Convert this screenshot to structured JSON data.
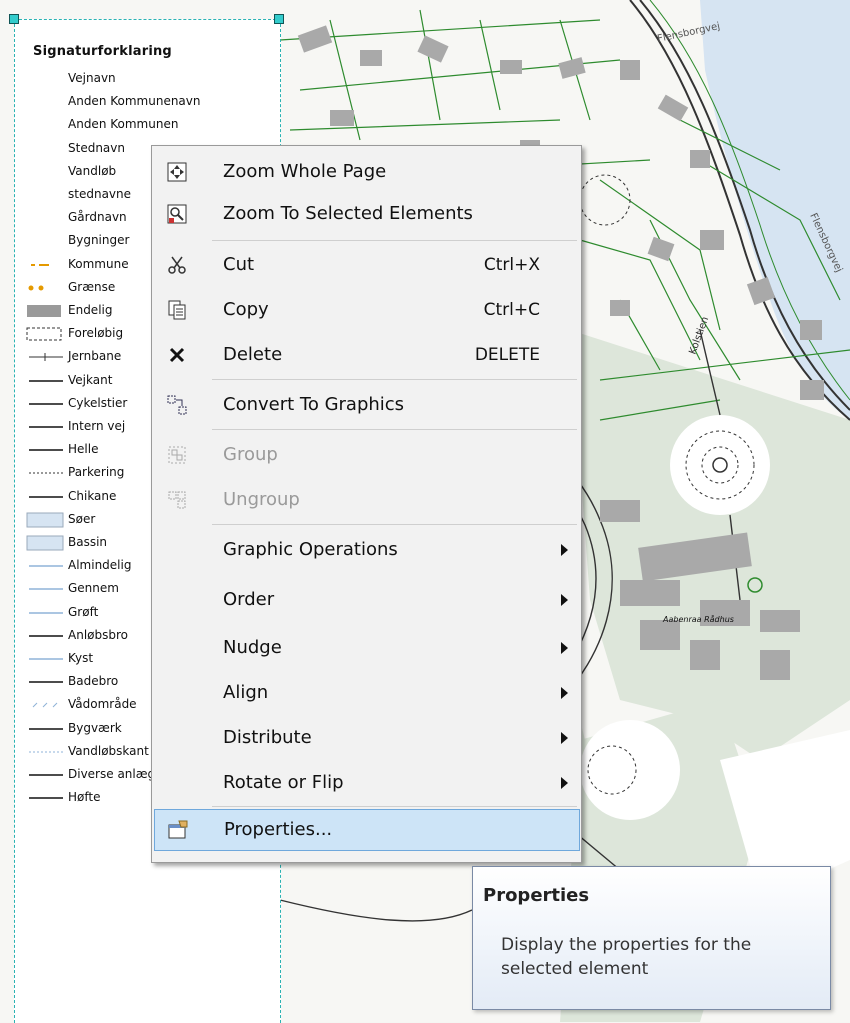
{
  "map": {
    "street_labels": [
      "Flensborgvej",
      "Flensborgvej",
      "Kolstien"
    ],
    "building_label": "Aabenraa Rådhus"
  },
  "legend": {
    "title": "Signaturforklaring",
    "items": [
      {
        "label": "Vejnavn",
        "symbol": "none"
      },
      {
        "label": "Anden Kommunenavn",
        "symbol": "none"
      },
      {
        "label": "Anden Kommunen",
        "symbol": "none"
      },
      {
        "label": "Stednavn",
        "symbol": "none"
      },
      {
        "label": "Vandløb",
        "symbol": "none"
      },
      {
        "label": "stednavne",
        "symbol": "none"
      },
      {
        "label": "Gårdnavn",
        "symbol": "none"
      },
      {
        "label": "Bygninger",
        "symbol": "none"
      },
      {
        "label": "Kommune",
        "symbol": "dash-dot-orange"
      },
      {
        "label": "Grænse",
        "symbol": "dots-orange"
      },
      {
        "label": "Endelig",
        "symbol": "fill-gray"
      },
      {
        "label": "Foreløbig",
        "symbol": "dashed-box"
      },
      {
        "label": "Jernbane",
        "symbol": "rail"
      },
      {
        "label": "Vejkant",
        "symbol": "line"
      },
      {
        "label": "Cykelstier",
        "symbol": "line"
      },
      {
        "label": "Intern vej",
        "symbol": "line"
      },
      {
        "label": "Helle",
        "symbol": "line"
      },
      {
        "label": "Parkering",
        "symbol": "dotted"
      },
      {
        "label": "Chikane",
        "symbol": "line"
      },
      {
        "label": "Søer",
        "symbol": "fill-blue"
      },
      {
        "label": "Bassin",
        "symbol": "fill-blue"
      },
      {
        "label": "Almindelig",
        "symbol": "line-blue"
      },
      {
        "label": "Gennem",
        "symbol": "line-blue"
      },
      {
        "label": "Grøft",
        "symbol": "line-blue"
      },
      {
        "label": "Anløbsbro",
        "symbol": "line"
      },
      {
        "label": "Kyst",
        "symbol": "line-blue"
      },
      {
        "label": "Badebro",
        "symbol": "line"
      },
      {
        "label": "Vådområde",
        "symbol": "marsh"
      },
      {
        "label": "Bygværk",
        "symbol": "line"
      },
      {
        "label": "Vandløbskant",
        "symbol": "dotted-blue"
      },
      {
        "label": "Diverse anlæg",
        "symbol": "line"
      },
      {
        "label": "Høfte",
        "symbol": "line"
      }
    ]
  },
  "context_menu": {
    "items": [
      {
        "label": "Zoom Whole Page",
        "icon": "zoom-whole-page-icon",
        "shortcut": "",
        "submenu": false,
        "disabled": false
      },
      {
        "label": "Zoom To Selected Elements",
        "icon": "zoom-selected-icon",
        "shortcut": "",
        "submenu": false,
        "disabled": false
      },
      {
        "label": "Cut",
        "icon": "scissors-icon",
        "shortcut": "Ctrl+X",
        "submenu": false,
        "disabled": false
      },
      {
        "label": "Copy",
        "icon": "copy-icon",
        "shortcut": "Ctrl+C",
        "submenu": false,
        "disabled": false
      },
      {
        "label": "Delete",
        "icon": "delete-x-icon",
        "shortcut": "DELETE",
        "submenu": false,
        "disabled": false
      },
      {
        "label": "Convert To Graphics",
        "icon": "convert-graphics-icon",
        "shortcut": "",
        "submenu": false,
        "disabled": false
      },
      {
        "label": "Group",
        "icon": "group-icon",
        "shortcut": "",
        "submenu": false,
        "disabled": true
      },
      {
        "label": "Ungroup",
        "icon": "ungroup-icon",
        "shortcut": "",
        "submenu": false,
        "disabled": true
      },
      {
        "label": "Graphic Operations",
        "icon": "",
        "shortcut": "",
        "submenu": true,
        "disabled": false
      },
      {
        "label": "Order",
        "icon": "",
        "shortcut": "",
        "submenu": true,
        "disabled": false
      },
      {
        "label": "Nudge",
        "icon": "",
        "shortcut": "",
        "submenu": true,
        "disabled": false
      },
      {
        "label": "Align",
        "icon": "",
        "shortcut": "",
        "submenu": true,
        "disabled": false
      },
      {
        "label": "Distribute",
        "icon": "",
        "shortcut": "",
        "submenu": true,
        "disabled": false
      },
      {
        "label": "Rotate or Flip",
        "icon": "",
        "shortcut": "",
        "submenu": true,
        "disabled": false
      },
      {
        "label": "Properties...",
        "icon": "properties-icon",
        "shortcut": "",
        "submenu": false,
        "disabled": false,
        "highlighted": true
      }
    ]
  },
  "tooltip": {
    "title": "Properties",
    "body": "Display the properties for the selected element"
  },
  "colors": {
    "map_line": "#2e8b2e",
    "building": "#a9a9a9",
    "water": "#d6e4f2",
    "green_area": "#dfe8dc",
    "menu_highlight": "#cde4f7",
    "selection": "#2bb3b3"
  }
}
